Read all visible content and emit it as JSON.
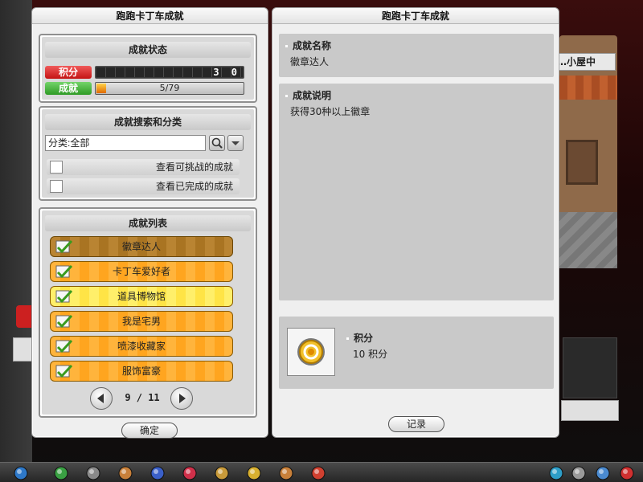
{
  "background": {
    "sign_text": "…小屋中"
  },
  "left_window": {
    "title": "跑跑卡丁车成就",
    "status": {
      "header": "成就状态",
      "score_label": "积分",
      "score_digits": "3 0",
      "achievement_label": "成就",
      "achievement_progress_text": "5/79",
      "achievement_progress_fraction": 0.063
    },
    "search": {
      "header": "成就搜索和分类",
      "category_value": "分类:全部",
      "filters": [
        {
          "label": "查看可挑战的成就",
          "checked": false
        },
        {
          "label": "查看已完成的成就",
          "checked": false
        }
      ]
    },
    "list": {
      "header": "成就列表",
      "items": [
        {
          "label": "徽章达人",
          "state": "selected"
        },
        {
          "label": "卡丁车爱好者",
          "state": "normal"
        },
        {
          "label": "道具博物馆",
          "state": "highlight"
        },
        {
          "label": "我是宅男",
          "state": "normal"
        },
        {
          "label": "喷漆收藏家",
          "state": "normal"
        },
        {
          "label": "服饰富豪",
          "state": "normal"
        }
      ],
      "page_text": "9 / 11"
    },
    "confirm_label": "确定"
  },
  "right_window": {
    "title": "跑跑卡丁车成就",
    "name_title": "成就名称",
    "name_value": "徽章达人",
    "desc_title": "成就说明",
    "desc_value": "获得30种以上徽章",
    "reward_title": "积分",
    "reward_value": "10 积分",
    "record_label": "记录"
  },
  "taskbar": {
    "icons": [
      "home-icon",
      "back-icon",
      "cart-icon",
      "character-icon",
      "potion-icon",
      "heart-icon",
      "brush-icon",
      "flag-icon",
      "book-icon",
      "kart-icon",
      "network-icon",
      "tools-icon",
      "search-icon",
      "power-icon"
    ]
  },
  "colors": {
    "accent_orange": "#ffa51f",
    "score_red": "#c41414",
    "achievement_green": "#2f9b25"
  }
}
